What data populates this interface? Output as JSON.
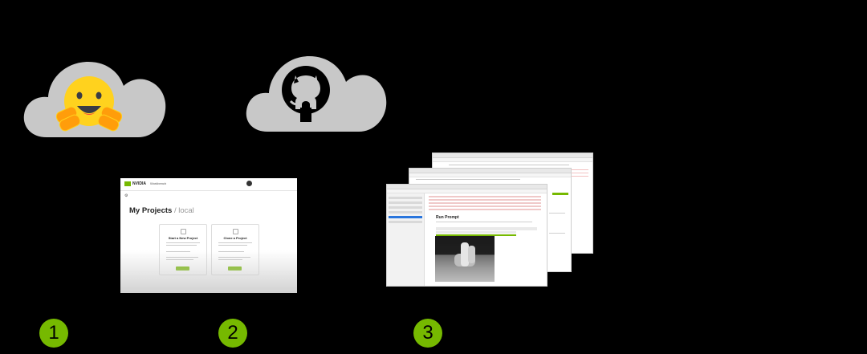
{
  "steps": [
    {
      "label": "1"
    },
    {
      "label": "2"
    },
    {
      "label": "3"
    }
  ],
  "colors": {
    "background": "#000000",
    "cloud": "#c8c8c8",
    "accent_green": "#76b900",
    "hf_yellow": "#ffd21e",
    "hf_orange": "#ff9d0b"
  },
  "icons": {
    "cloud_1": "hugging-face-icon",
    "cloud_2": "github-icon"
  },
  "workbench": {
    "brand": "NVIDIA",
    "product": "Workbench",
    "page_title": "My Projects",
    "location": "/ local",
    "cards": [
      {
        "title": "Start a New Project"
      },
      {
        "title": "Clone a Project"
      }
    ]
  },
  "notebook": {
    "heading": "Run Prompt"
  }
}
